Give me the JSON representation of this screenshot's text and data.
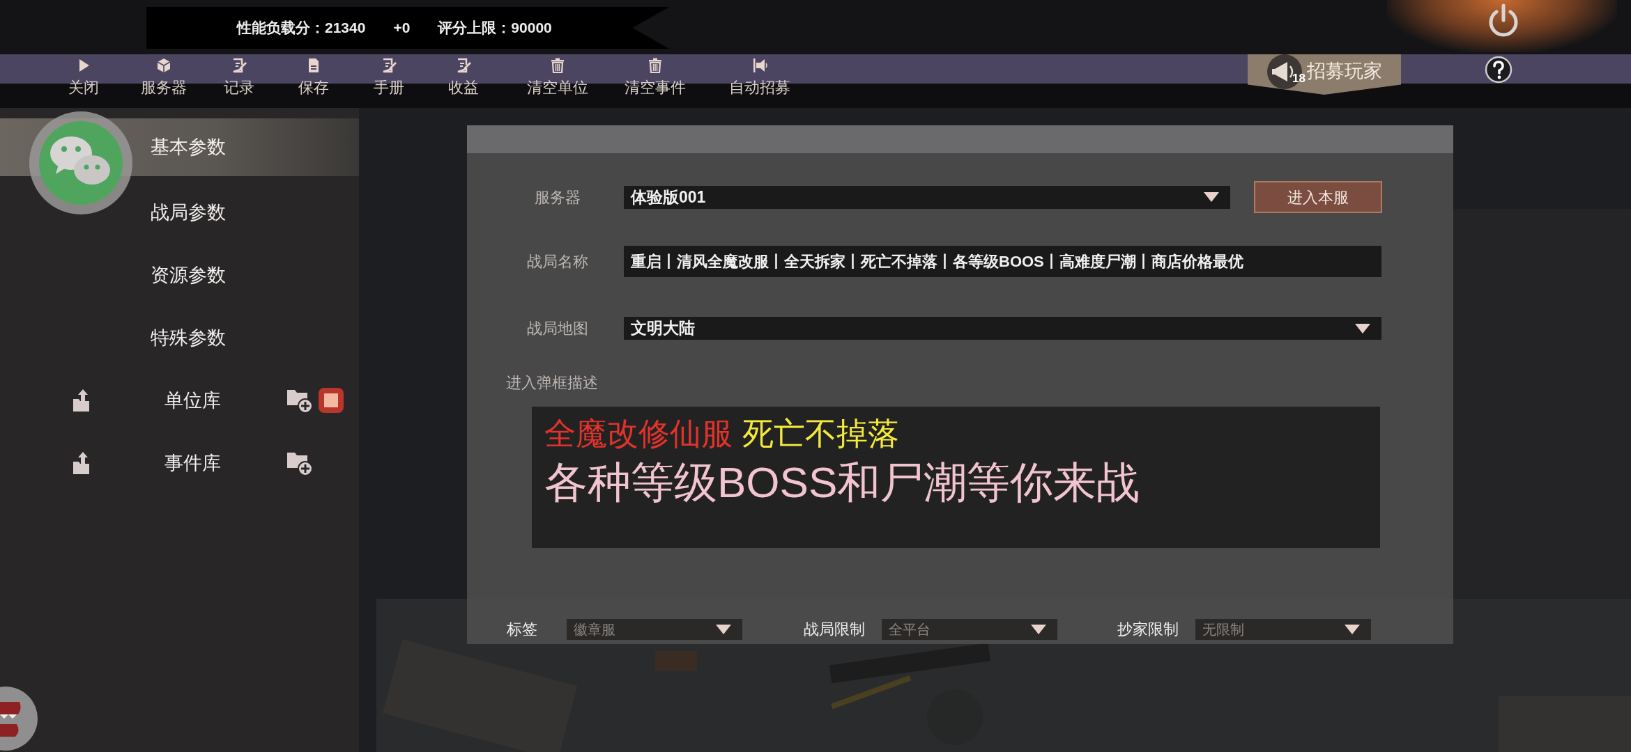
{
  "score_banner": {
    "load_label": "性能负载分：21340",
    "delta": "+0",
    "limit_label": "评分上限：90000"
  },
  "toolbar": [
    {
      "label": "关闭"
    },
    {
      "label": "服务器"
    },
    {
      "label": "记录"
    },
    {
      "label": "保存"
    },
    {
      "label": "手册"
    },
    {
      "label": "收益"
    },
    {
      "label": "清空单位"
    },
    {
      "label": "清空事件"
    },
    {
      "label": "自动招募"
    }
  ],
  "recruit_button": {
    "label": "招募玩家",
    "badge": "18"
  },
  "sidebar": {
    "items": [
      {
        "kind": "tab",
        "label": "基本参数",
        "selected": true
      },
      {
        "kind": "tab",
        "label": "战局参数",
        "selected": false
      },
      {
        "kind": "tab",
        "label": "资源参数",
        "selected": false
      },
      {
        "kind": "tab",
        "label": "特殊参数",
        "selected": false
      },
      {
        "kind": "library",
        "label": "单位库",
        "selected": false,
        "alert": true
      },
      {
        "kind": "library",
        "label": "事件库",
        "selected": false,
        "alert": false
      }
    ]
  },
  "form": {
    "server": {
      "label": "服务器",
      "value": "体验版001",
      "button": "进入本服"
    },
    "match_name": {
      "label": "战局名称",
      "value": "重启丨清风全魔改服丨全天拆家丨死亡不掉落丨各等级BOOS丨高难度尸潮丨商店价格最优"
    },
    "match_map": {
      "label": "战局地图",
      "value": "文明大陆"
    },
    "popup_description": {
      "label": "进入弹框描述",
      "lines": [
        [
          {
            "text": "全魔改修仙服",
            "color": "#e2332b"
          },
          {
            "text": "死亡不掉落",
            "color": "#f3ea3c"
          }
        ],
        [
          {
            "text": "各种等级BOSS和尸潮等你来战",
            "color": "#f2c4cf"
          }
        ]
      ]
    },
    "bottom_selects": [
      {
        "label": "标签",
        "value": "徽章服",
        "disabled": true
      },
      {
        "label": "战局限制",
        "value": "全平台",
        "disabled": true
      },
      {
        "label": "抄家限制",
        "value": "无限制",
        "disabled": true
      }
    ]
  }
}
